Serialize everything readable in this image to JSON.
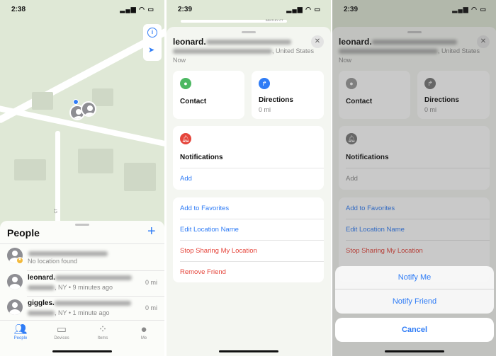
{
  "panel1": {
    "time": "2:38",
    "sheet_title": "People",
    "add_label": "+",
    "people": [
      {
        "name": "",
        "subtitle": "No location found",
        "distance": ""
      },
      {
        "name": "leonard.",
        "subtitle": ", NY • 9 minutes ago",
        "distance": "0 mi"
      },
      {
        "name": "giggles.",
        "subtitle": ", NY • 1 minute ago",
        "distance": "0 mi"
      }
    ],
    "tabs": [
      {
        "label": "People",
        "icon": "people-icon",
        "active": true
      },
      {
        "label": "Devices",
        "icon": "devices-icon"
      },
      {
        "label": "Items",
        "icon": "items-icon"
      },
      {
        "label": "Me",
        "icon": "me-icon"
      }
    ],
    "map_buttons": [
      "info-icon",
      "location-arrow-icon"
    ],
    "map_label": "CT"
  },
  "panel2": {
    "time": "2:39",
    "street": "BENTLEY CT",
    "name": "leonard.",
    "address": ", United States",
    "updated": "Now",
    "contact": "Contact",
    "directions": "Directions",
    "directions_distance": "0 mi",
    "notifications": "Notifications",
    "notifications_add": "Add",
    "actions": [
      "Add to Favorites",
      "Edit Location Name",
      "Stop Sharing My Location",
      "Remove Friend"
    ]
  },
  "panel3": {
    "time": "2:39",
    "name": "leonard.",
    "address": ", United States",
    "updated": "Now",
    "contact": "Contact",
    "directions": "Directions",
    "directions_distance": "0 mi",
    "notifications": "Notifications",
    "notifications_add": "Add",
    "actions": [
      "Add to Favorites",
      "Edit Location Name",
      "Stop Sharing My Location"
    ],
    "sheet_options": [
      "Notify Me",
      "Notify Friend"
    ],
    "cancel": "Cancel"
  },
  "colors": {
    "accent": "#2f7cf6",
    "destructive": "#e5453b",
    "contact": "#4cb862",
    "notification": "#e5453b"
  }
}
